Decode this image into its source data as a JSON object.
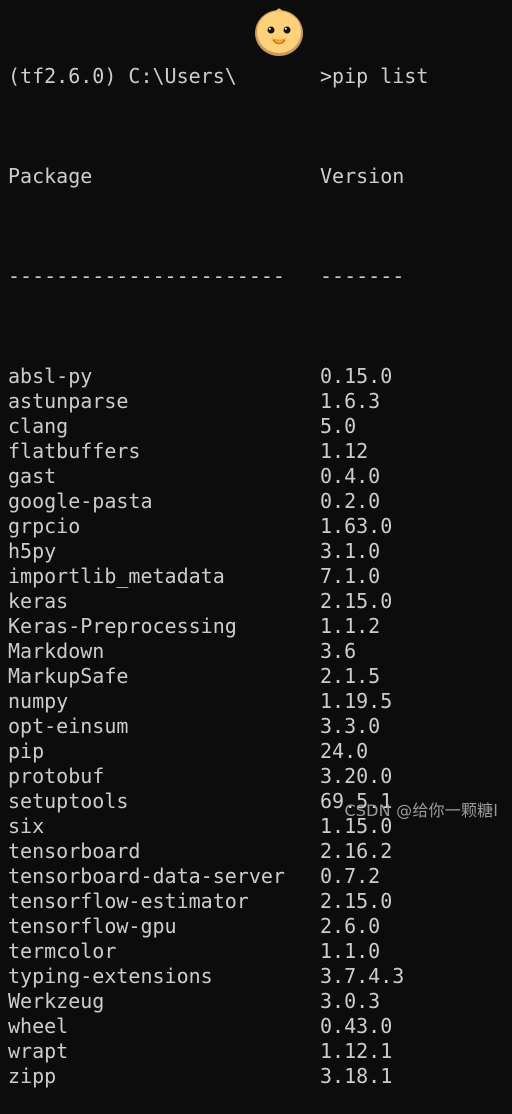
{
  "prompt": {
    "prefix": "(tf2.6.0) C:\\Users\\",
    "suffix": ">pip list"
  },
  "header": {
    "package": "Package",
    "version": "Version",
    "package_rule": "-----------------------",
    "version_rule": "-------"
  },
  "packages": [
    {
      "name": "absl-py",
      "version": "0.15.0"
    },
    {
      "name": "astunparse",
      "version": "1.6.3"
    },
    {
      "name": "clang",
      "version": "5.0"
    },
    {
      "name": "flatbuffers",
      "version": "1.12"
    },
    {
      "name": "gast",
      "version": "0.4.0"
    },
    {
      "name": "google-pasta",
      "version": "0.2.0"
    },
    {
      "name": "grpcio",
      "version": "1.63.0"
    },
    {
      "name": "h5py",
      "version": "3.1.0"
    },
    {
      "name": "importlib_metadata",
      "version": "7.1.0"
    },
    {
      "name": "keras",
      "version": "2.15.0"
    },
    {
      "name": "Keras-Preprocessing",
      "version": "1.1.2"
    },
    {
      "name": "Markdown",
      "version": "3.6"
    },
    {
      "name": "MarkupSafe",
      "version": "2.1.5"
    },
    {
      "name": "numpy",
      "version": "1.19.5"
    },
    {
      "name": "opt-einsum",
      "version": "3.3.0"
    },
    {
      "name": "pip",
      "version": "24.0"
    },
    {
      "name": "protobuf",
      "version": "3.20.0"
    },
    {
      "name": "setuptools",
      "version": "69.5.1"
    },
    {
      "name": "six",
      "version": "1.15.0"
    },
    {
      "name": "tensorboard",
      "version": "2.16.2"
    },
    {
      "name": "tensorboard-data-server",
      "version": "0.7.2"
    },
    {
      "name": "tensorflow-estimator",
      "version": "2.15.0"
    },
    {
      "name": "tensorflow-gpu",
      "version": "2.6.0"
    },
    {
      "name": "termcolor",
      "version": "1.1.0"
    },
    {
      "name": "typing-extensions",
      "version": "3.7.4.3"
    },
    {
      "name": "Werkzeug",
      "version": "3.0.3"
    },
    {
      "name": "wheel",
      "version": "0.43.0"
    },
    {
      "name": "wrapt",
      "version": "1.12.1"
    },
    {
      "name": "zipp",
      "version": "3.18.1"
    }
  ],
  "watermark": "CSDN @给你一颗糖l",
  "colors": {
    "background": "#0c0c0c",
    "text": "#cccccc",
    "watermark": "#9a9a9a"
  },
  "icons": {
    "avatar": "duckling-avatar"
  }
}
